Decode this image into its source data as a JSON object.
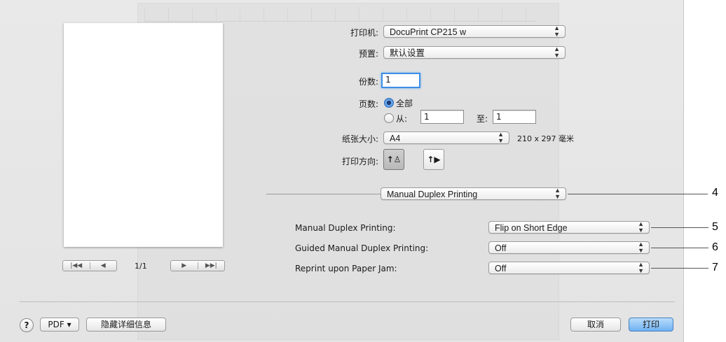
{
  "printer": {
    "label": "打印机:",
    "value": "DocuPrint CP215 w"
  },
  "preset": {
    "label": "预置:",
    "value": "默认设置"
  },
  "copies": {
    "label": "份数:",
    "value": "1"
  },
  "pages": {
    "label": "页数:",
    "all_label": "全部",
    "from_label": "从:",
    "from_value": "1",
    "to_label": "至:",
    "to_value": "1",
    "selected": "all"
  },
  "paper_size": {
    "label": "纸张大小:",
    "value": "A4",
    "dimensions": "210 x 297 毫米"
  },
  "orientation": {
    "label": "打印方向:",
    "selected": "portrait"
  },
  "panel_select": {
    "value": "Manual Duplex Printing"
  },
  "settings": [
    {
      "label": "Manual Duplex Printing:",
      "value": "Flip on Short Edge",
      "callout": "5"
    },
    {
      "label": "Guided Manual Duplex Printing:",
      "value": "Off",
      "callout": "6"
    },
    {
      "label": "Reprint upon Paper Jam:",
      "value": "Off",
      "callout": "7"
    }
  ],
  "panel_callout": "4",
  "preview_nav": {
    "page_indicator": "1/1"
  },
  "footer": {
    "help": "?",
    "pdf_label": "PDF ▾",
    "hide_details_label": "隐藏详细信息",
    "cancel_label": "取消",
    "print_label": "打印"
  }
}
